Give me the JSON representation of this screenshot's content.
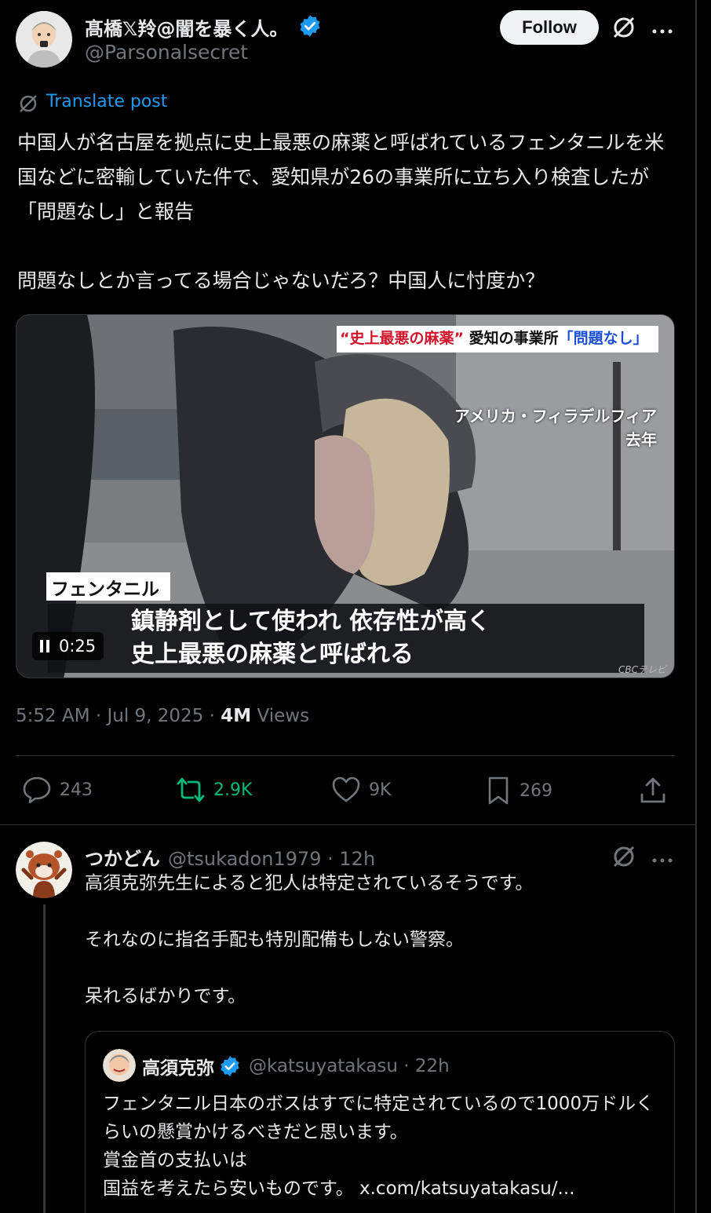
{
  "post": {
    "author_name": "髙橋𝕏羚@闇を暴く人。",
    "author_handle": "@Parsonalsecret",
    "follow_label": "Follow",
    "translate_label": "Translate post",
    "text": "中国人が名古屋を拠点に史上最悪の麻薬と呼ばれているフェンタニルを米国などに密輸していた件で、愛知県が26の事業所に立ち入り検査したが「問題なし」と報告\n\n問題なしとか言ってる場合じゃないだろ？中国人に忖度か？",
    "video": {
      "top_caption_quote": "“史上最悪の麻薬”",
      "top_caption_main": "愛知の事業所",
      "top_caption_highlight": "「問題なし」",
      "location_line1": "アメリカ・フィラデルフィア",
      "location_line2": "去年",
      "label_tag": "フェンタニル",
      "subtitle_line1": "鎮静剤として使われ 依存性が高く",
      "subtitle_line2": "史上最悪の麻薬と呼ばれる",
      "time": "0:25",
      "watermark": "CBCテレビ"
    },
    "timestamp": "5:52 AM · Jul 9, 2025 · ",
    "views_count": "4M",
    "views_label": " Views",
    "actions": {
      "replies": "243",
      "reposts": "2.9K",
      "likes": "9K",
      "bookmarks": "269"
    },
    "colors": {
      "accent": "#1d9bf0",
      "repost": "#00ba7c",
      "verified": "#1d9bf0"
    }
  },
  "reply": {
    "author_name": "つかどん",
    "author_handle": "@tsukadon1979",
    "time": " · 12h",
    "text": "高須克弥先生によると犯人は特定されているそうです。\n\nそれなのに指名手配も特別配備もしない警察。\n\n呆れるばかりです。",
    "quote": {
      "author_name": "高須克弥",
      "author_handle": "@katsuyatakasu",
      "time": " · 22h",
      "text": "フェンタニル日本のボスはすでに特定されているので1000万ドルくらいの懸賞かけるべきだと思います。\n賞金首の支払いは\n国益を考えたら安いものです。 x.com/katsuyatakasu/..."
    }
  }
}
